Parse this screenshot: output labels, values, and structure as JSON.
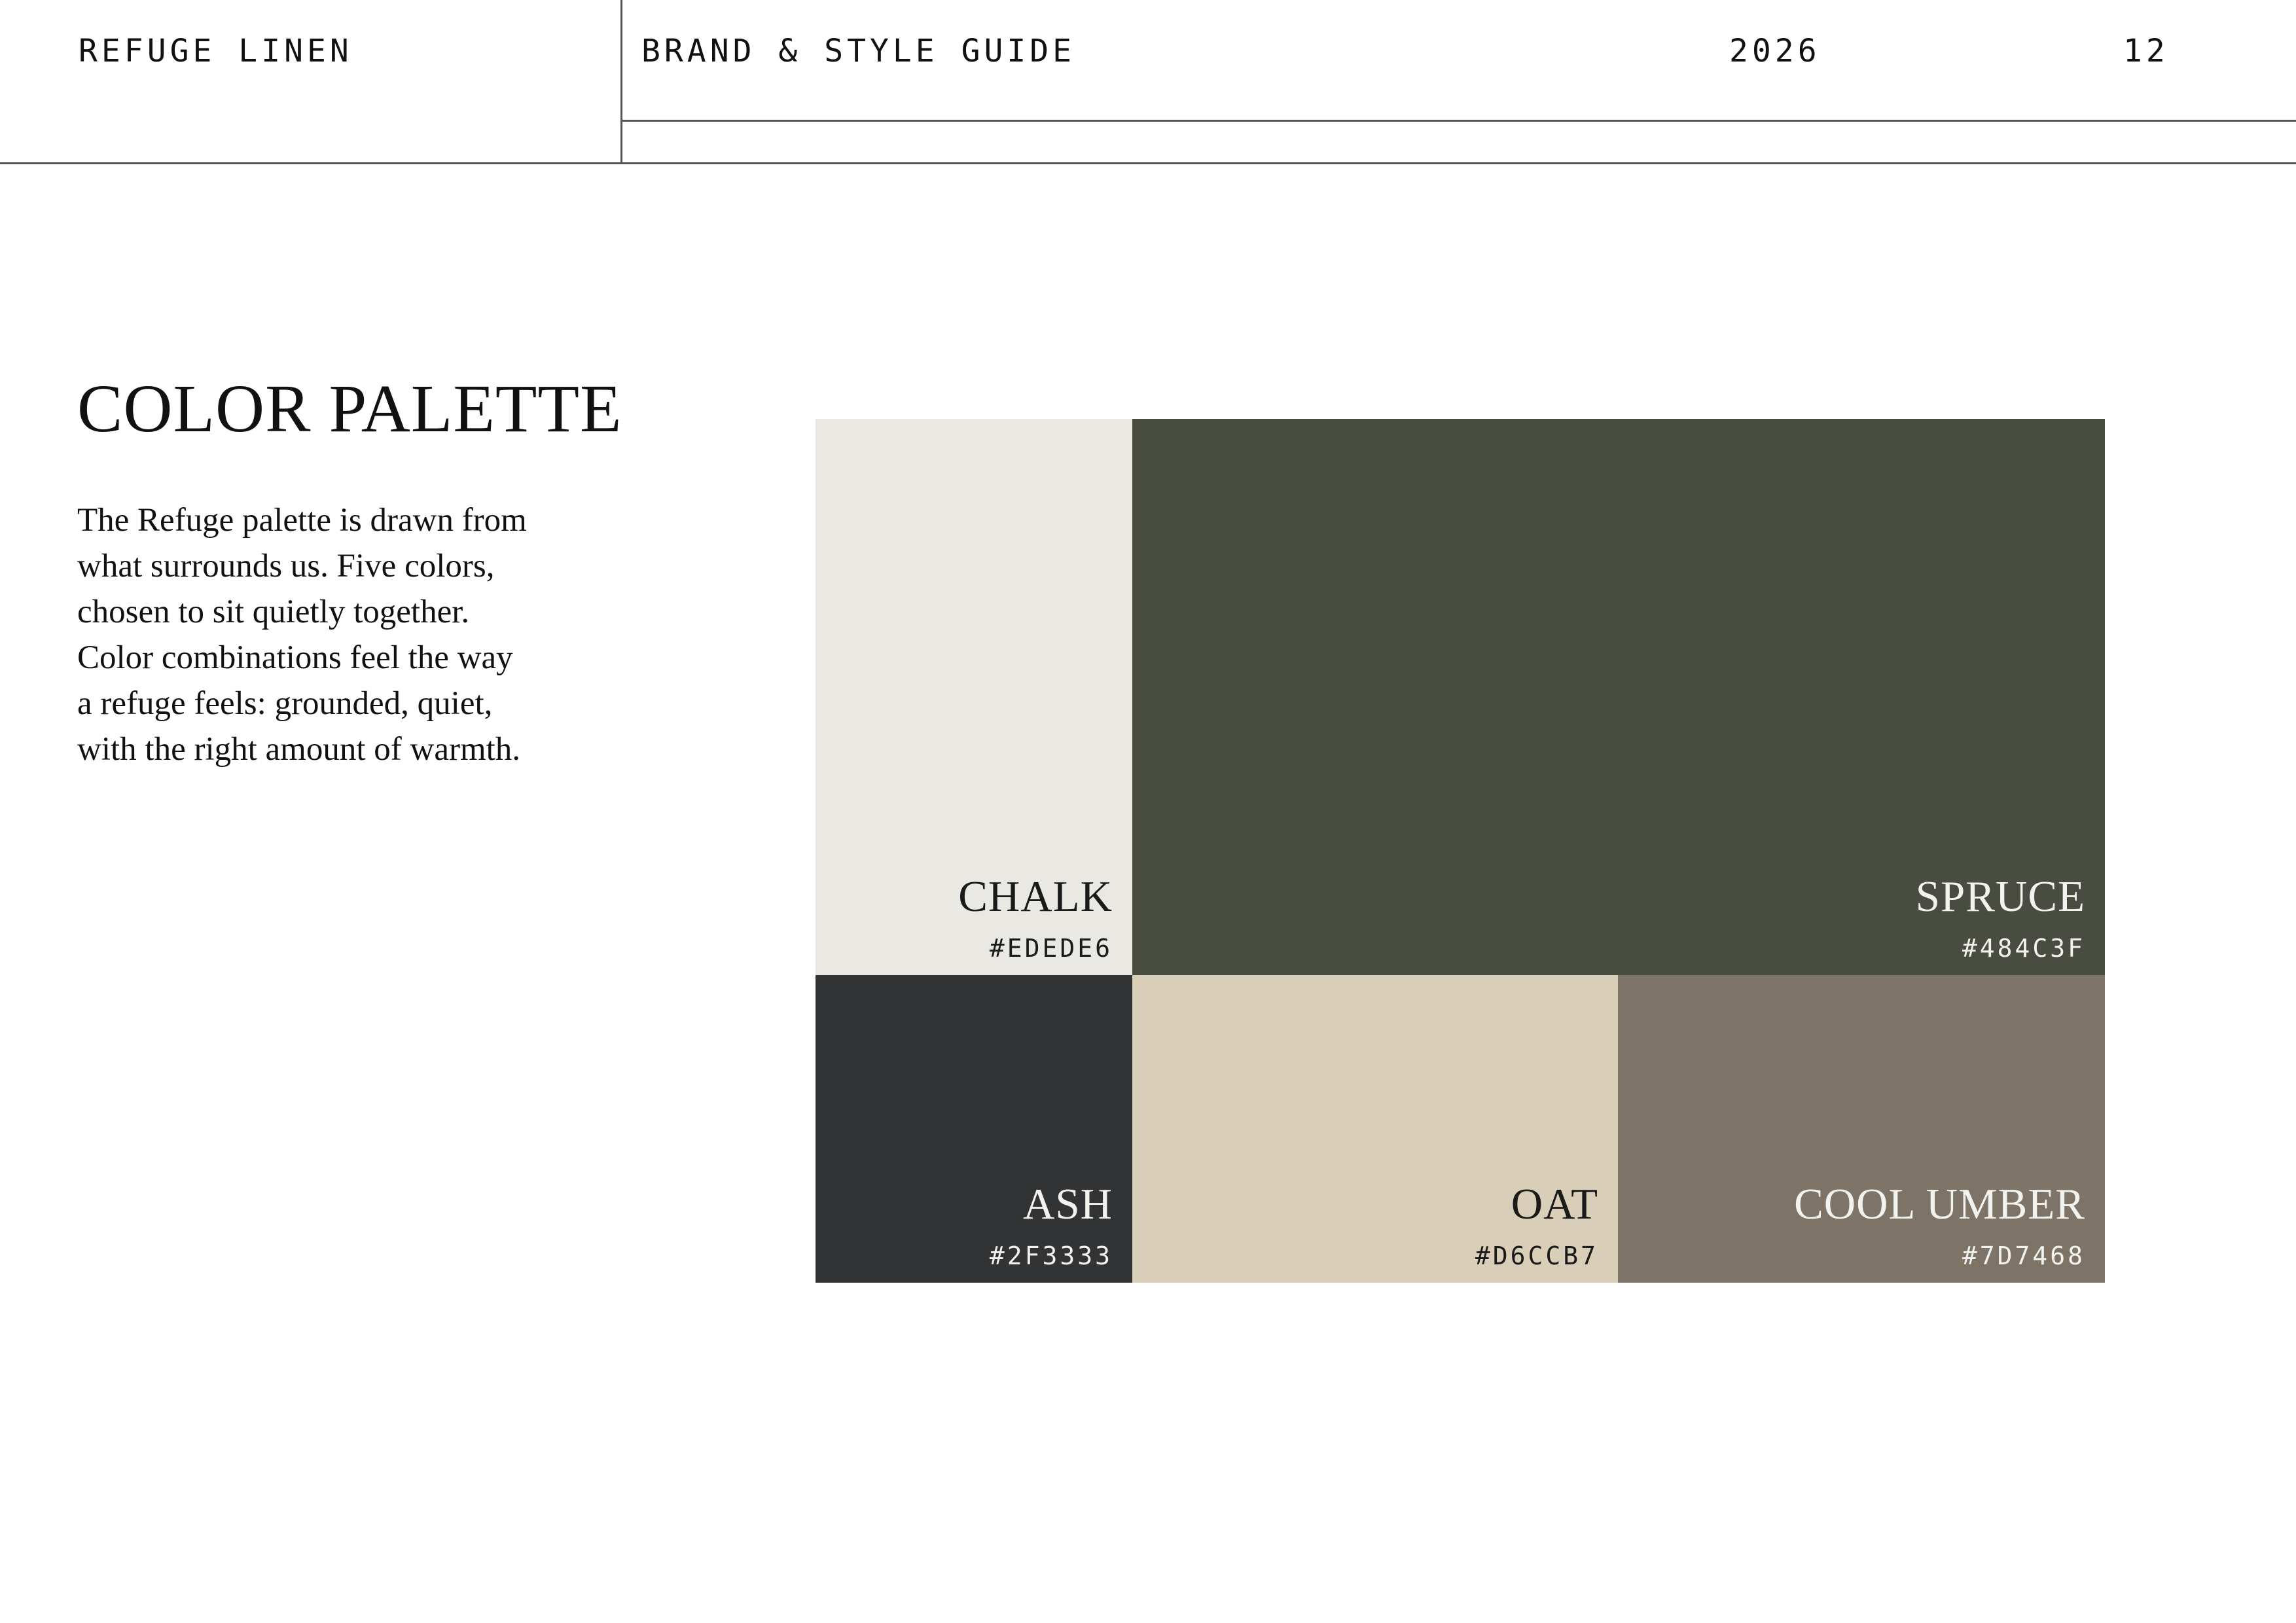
{
  "header": {
    "brand": "REFUGE LINEN",
    "section": "BRAND & STYLE GUIDE",
    "year": "2026",
    "page_number": "12"
  },
  "main": {
    "title": "COLOR PALETTE",
    "body": "The Refuge palette is drawn from\nwhat surrounds us. Five colors,\nchosen to sit quietly together.\nColor combinations feel the way\na refuge feels: grounded, quiet,\nwith the right amount of warmth."
  },
  "palette": {
    "swatches": [
      {
        "name": "CHALK",
        "hex": "#EDEDE6",
        "color": "#E9E8E3",
        "text_color": "#1a1a1a"
      },
      {
        "name": "SPRUCE",
        "hex": "#484C3F",
        "color": "#484C41",
        "text_color": "#f2f2ee"
      },
      {
        "name": "ASH",
        "hex": "#2F3333",
        "color": "#323335",
        "text_color": "#f2f2ee"
      },
      {
        "name": "OAT",
        "hex": "#D6CCB7",
        "color": "#D9CEB8",
        "text_color": "#1a1a1a"
      },
      {
        "name": "COOL UMBER",
        "hex": "#7D7468",
        "color": "#7D7467",
        "text_color": "#f2f2ee"
      }
    ]
  }
}
